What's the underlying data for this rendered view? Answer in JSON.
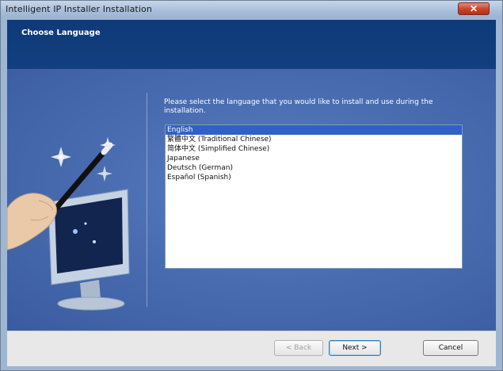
{
  "window": {
    "title": "Intelligent IP Installer Installation",
    "close_label": "✕"
  },
  "header": {
    "title": "Choose Language"
  },
  "main": {
    "prompt": "Please select the language that you would like to install and use during the installation.",
    "languages": [
      "English",
      "繁體中文 (Traditional Chinese)",
      "简体中文 (Simplified Chinese)",
      "Japanese",
      "Deutsch (German)",
      "Español (Spanish)"
    ],
    "selected_index": 0
  },
  "buttons": {
    "back": "< Back",
    "next": "Next >",
    "cancel": "Cancel"
  },
  "colors": {
    "header_band": "#123f80",
    "body_panel": "#4a6db2",
    "selection": "#3161c4"
  },
  "icons": {
    "illustration": "magic-wand-monitor-illustration"
  }
}
